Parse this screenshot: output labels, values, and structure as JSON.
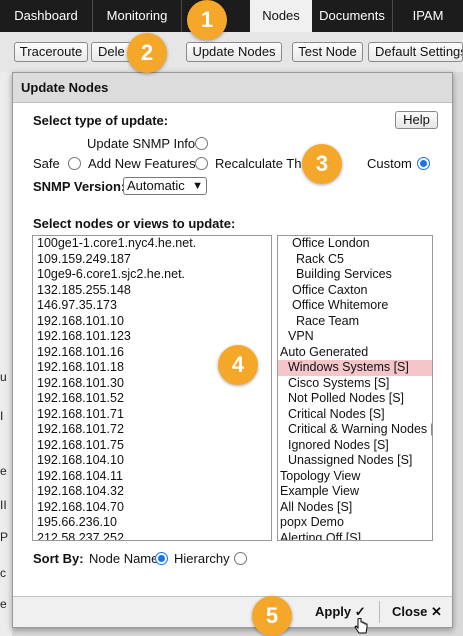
{
  "nav": {
    "tabs": [
      "Dashboard",
      "Monitoring",
      "",
      "Nodes",
      "Documents",
      "IPAM"
    ],
    "active_tab": "Nodes"
  },
  "toolbar": {
    "buttons": [
      "Traceroute",
      "Dele",
      "Update Nodes",
      "Test Node",
      "Default Settings"
    ]
  },
  "background_fragments": [
    "u",
    "I",
    "e",
    "II",
    "P",
    "c",
    "e"
  ],
  "dialog": {
    "title": "Update Nodes",
    "type_heading": "Select type of update:",
    "help_label": "Help",
    "options": {
      "snmp_info": "Update SNMP Info",
      "safe": "Safe",
      "add_features": "Add New Features",
      "recalculate": "Recalculate Thre",
      "custom": "Custom"
    },
    "selected_option": "Custom",
    "snmp_version_label": "SNMP Version:",
    "snmp_version_value": "Automatic",
    "nodes_heading": "Select nodes or views to update:",
    "nodes": [
      "100ge1-1.core1.nyc4.he.net.",
      "109.159.249.187",
      "10ge9-6.core1.sjc2.he.net.",
      "132.185.255.148",
      "146.97.35.173",
      "192.168.101.10",
      "192.168.101.123",
      "192.168.101.16",
      "192.168.101.18",
      "192.168.101.30",
      "192.168.101.52",
      "192.168.101.71",
      "192.168.101.72",
      "192.168.101.75",
      "192.168.104.10",
      "192.168.104.11",
      "192.168.104.32",
      "192.168.104.70",
      "195.66.236.10",
      "212.58.237.252"
    ],
    "views": [
      {
        "label": "Office London",
        "indent": 3
      },
      {
        "label": "Rack C5",
        "indent": 4
      },
      {
        "label": "Building Services",
        "indent": 4
      },
      {
        "label": "Office Caxton",
        "indent": 3
      },
      {
        "label": "Office Whitemore",
        "indent": 3
      },
      {
        "label": "Race Team",
        "indent": 4
      },
      {
        "label": "VPN",
        "indent": 2
      },
      {
        "label": "Auto Generated",
        "indent": 0
      },
      {
        "label": "Windows Systems [S]",
        "indent": 2,
        "selected": true
      },
      {
        "label": "Cisco Systems [S]",
        "indent": 2
      },
      {
        "label": "Not Polled Nodes [S]",
        "indent": 2
      },
      {
        "label": "Critical Nodes [S]",
        "indent": 2
      },
      {
        "label": "Critical & Warning Nodes [S]",
        "indent": 2
      },
      {
        "label": "Ignored Nodes [S]",
        "indent": 2
      },
      {
        "label": "Unassigned Nodes [S]",
        "indent": 2
      },
      {
        "label": "Topology View",
        "indent": 0
      },
      {
        "label": "Example View",
        "indent": 0
      },
      {
        "label": "All Nodes [S]",
        "indent": 0
      },
      {
        "label": "popx Demo",
        "indent": 0
      },
      {
        "label": "Alerting Off [S]",
        "indent": 0
      }
    ],
    "sort_by_label": "Sort By:",
    "sort_node_name": "Node Name",
    "sort_hierarchy": "Hierarchy",
    "sort_selected": "Node Name",
    "apply_label": "Apply ✓",
    "close_label": "Close ✕"
  },
  "callouts": [
    "1",
    "2",
    "3",
    "4",
    "5"
  ],
  "colors": {
    "nav_bg": "#1c1c1c",
    "callout": "#f5a72a",
    "radio_on": "#1a73e8",
    "selected_row": "#f4c6c9"
  }
}
